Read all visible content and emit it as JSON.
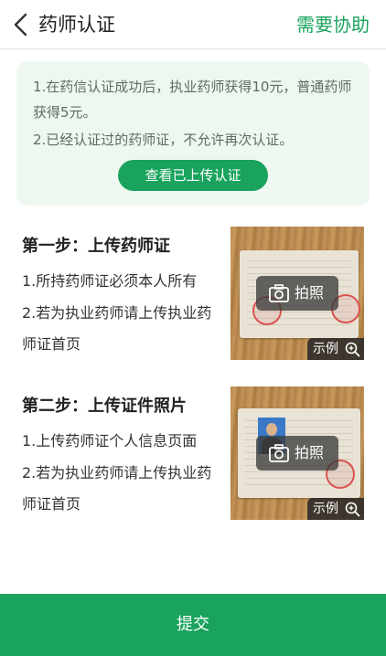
{
  "header": {
    "title": "药师认证",
    "help_label": "需要协助"
  },
  "notice": {
    "line1": "1.在药信认证成功后，执业药师获得10元，普通药师获得5元。",
    "line2": "2.已经认证过的药师证，不允许再次认证。",
    "button_label": "查看已上传认证"
  },
  "steps": [
    {
      "title": "第一步：上传药师证",
      "lines": [
        "1.所持药师证必须本人所有",
        "2.若为执业药师请上传执业药",
        "师证首页"
      ],
      "shoot_label": "拍照",
      "example_label": "示例"
    },
    {
      "title": "第二步：上传证件照片",
      "lines": [
        "1.上传药师证个人信息页面",
        "2.若为执业药师请上传执业药",
        "师证首页"
      ],
      "shoot_label": "拍照",
      "example_label": "示例"
    }
  ],
  "submit_label": "提交",
  "colors": {
    "accent": "#1aa35d",
    "notice_bg": "#eef8f1"
  },
  "icons": {
    "back": "chevron-left-icon",
    "camera": "camera-icon",
    "zoom": "zoom-in-icon"
  }
}
